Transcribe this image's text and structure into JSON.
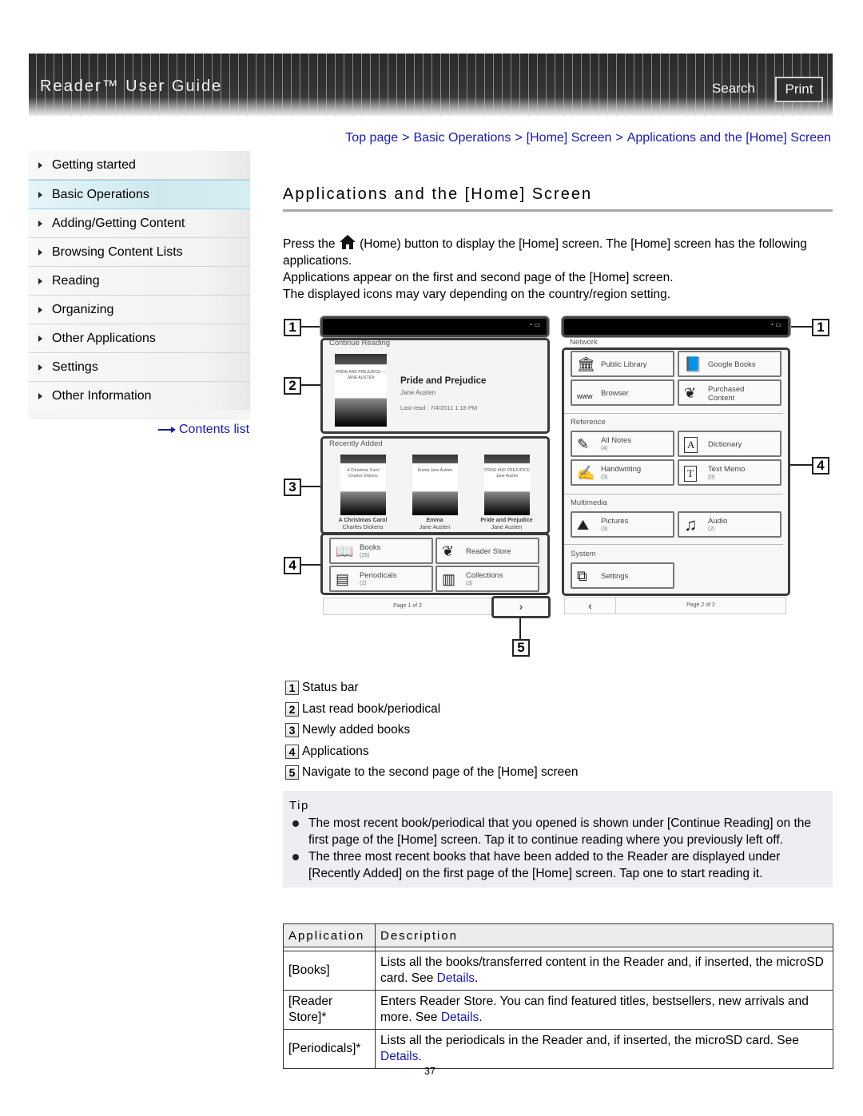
{
  "header": {
    "title": "Reader™ User Guide",
    "search_label": "Search",
    "print_label": "Print"
  },
  "sidebar": {
    "items": [
      {
        "label": "Getting started",
        "active": false
      },
      {
        "label": "Basic Operations",
        "active": true
      },
      {
        "label": "Adding/Getting Content",
        "active": false
      },
      {
        "label": "Browsing Content Lists",
        "active": false
      },
      {
        "label": "Reading",
        "active": false
      },
      {
        "label": "Organizing",
        "active": false
      },
      {
        "label": "Other Applications",
        "active": false
      },
      {
        "label": "Settings",
        "active": false
      },
      {
        "label": "Other Information",
        "active": false
      }
    ],
    "contents_link": "Contents list"
  },
  "breadcrumb": {
    "items": [
      "Top page",
      "Basic Operations",
      "[Home] Screen",
      "Applications and the [Home] Screen"
    ],
    "separator": ">"
  },
  "page": {
    "title": "Applications and the [Home] Screen",
    "intro_prefix": "Press the",
    "intro_icon": "home-icon",
    "intro_suffix": "(Home) button to display the [Home] screen. The [Home] screen has the following applications.",
    "intro_line2": "Applications appear on the first and second page of the [Home] screen.",
    "intro_line3": "The displayed icons may vary depending on the country/region setting."
  },
  "figure": {
    "callouts": [
      "1",
      "2",
      "3",
      "4",
      "5"
    ],
    "screen1": {
      "continue_reading_label": "Continue Reading",
      "book_title": "Pride and Prejudice",
      "book_author": "Jane Austen",
      "last_read": "Last read : 7/4/2011 1:18 PM",
      "cover_text": "PRIDE AND PREJUDICE — JANE AUSTEN",
      "recently_added_label": "Recently Added",
      "recent_books": [
        {
          "title": "A Christmas Carol",
          "author": "Charles Dickens",
          "cover": "A Christmas Carol Charles Dickens"
        },
        {
          "title": "Emma",
          "author": "Jane Austen",
          "cover": "Emma Jane Austen"
        },
        {
          "title": "Pride and Prejudice",
          "author": "Jane Austen",
          "cover": "PRIDE AND PREJUDICE Jane Austen"
        }
      ],
      "apps": [
        {
          "label": "Books",
          "count": "(25)",
          "icon": "open-book-icon",
          "glyph": "📖"
        },
        {
          "label": "Reader Store",
          "count": "",
          "icon": "feather-icon",
          "glyph": "❦"
        },
        {
          "label": "Periodicals",
          "count": "(2)",
          "icon": "newspaper-icon",
          "glyph": "▤"
        },
        {
          "label": "Collections",
          "count": "(3)",
          "icon": "collections-icon",
          "glyph": "▥"
        }
      ],
      "page_indicator": "Page 1 of 2",
      "next_glyph": "›"
    },
    "screen2": {
      "sections": [
        {
          "label": "Network",
          "apps": [
            {
              "label": "Public Library",
              "count": "",
              "icon": "library-icon",
              "glyph": "🏛"
            },
            {
              "label": "Google Books",
              "count": "",
              "icon": "book-icon",
              "glyph": "📘"
            },
            {
              "label": "Browser",
              "count": "",
              "icon": "www-icon",
              "glyph": "www"
            },
            {
              "label": "Purchased Content",
              "count": "",
              "icon": "feather-icon",
              "glyph": "❦"
            }
          ]
        },
        {
          "label": "Reference",
          "apps": [
            {
              "label": "All Notes",
              "count": "(4)",
              "icon": "notes-icon",
              "glyph": "✎"
            },
            {
              "label": "Dictionary",
              "count": "",
              "icon": "dictionary-icon",
              "glyph": "A"
            },
            {
              "label": "Handwriting",
              "count": "(3)",
              "icon": "handwriting-icon",
              "glyph": "✍"
            },
            {
              "label": "Text Memo",
              "count": "(0)",
              "icon": "text-memo-icon",
              "glyph": "T"
            }
          ]
        },
        {
          "label": "Multimedia",
          "apps": [
            {
              "label": "Pictures",
              "count": "(3)",
              "icon": "picture-icon",
              "glyph": "⛰"
            },
            {
              "label": "Audio",
              "count": "(2)",
              "icon": "music-note-icon",
              "glyph": "♫"
            }
          ]
        },
        {
          "label": "System",
          "apps": [
            {
              "label": "Settings",
              "count": "",
              "icon": "toolbox-icon",
              "glyph": "⧉"
            }
          ]
        }
      ],
      "page_indicator": "Page 2 of 2",
      "prev_glyph": "‹"
    }
  },
  "legend": [
    {
      "num": "1",
      "text": "Status bar"
    },
    {
      "num": "2",
      "text": "Last read book/periodical"
    },
    {
      "num": "3",
      "text": "Newly added books"
    },
    {
      "num": "4",
      "text": "Applications"
    },
    {
      "num": "5",
      "text": "Navigate to the second page of the [Home] screen"
    }
  ],
  "tip": {
    "title": "Tip",
    "items": [
      "The most recent book/periodical that you opened is shown under [Continue Reading] on the first page of the [Home] screen. Tap it to continue reading where you previously left off.",
      "The three most recent books that have been added to the Reader are displayed under [Recently Added] on the first page of the [Home] screen. Tap one to start reading it."
    ]
  },
  "table": {
    "headers": [
      "Application",
      "Description"
    ],
    "rows": [
      {
        "app": "[Books]",
        "desc": "Lists all the books/transferred content in the Reader and, if inserted, the microSD card. See ",
        "link": "Details",
        "end": "."
      },
      {
        "app": "[Reader Store]*",
        "desc": "Enters Reader Store. You can find featured titles, bestsellers, new arrivals and more. See ",
        "link": "Details",
        "end": "."
      },
      {
        "app": "[Periodicals]*",
        "desc": "Lists all the periodicals in the Reader and, if inserted, the microSD card. See ",
        "link": "Details",
        "end": "."
      }
    ]
  },
  "footer": {
    "page_number": "37"
  },
  "colors": {
    "link": "#1a1aa6",
    "active_nav": "#cfe9ee",
    "tip_bg": "#eceef2"
  }
}
